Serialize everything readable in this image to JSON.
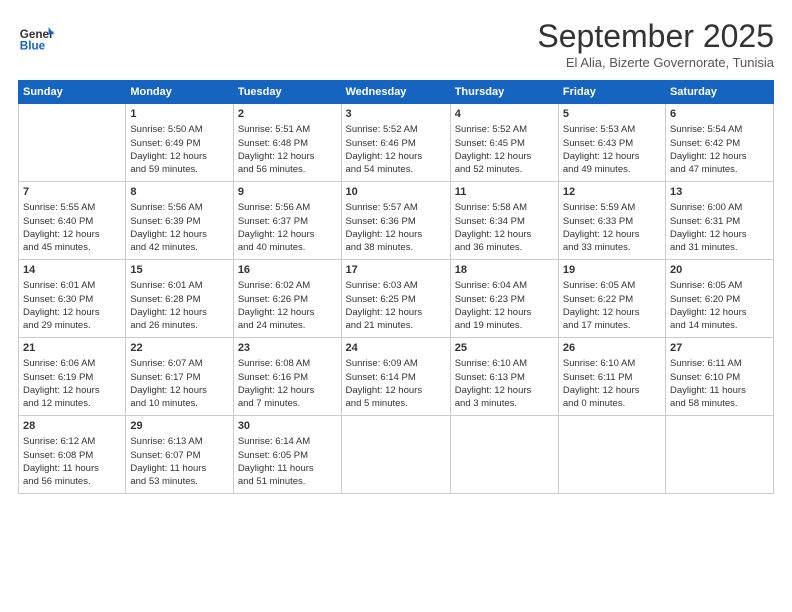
{
  "header": {
    "logo_general": "General",
    "logo_blue": "Blue",
    "month_title": "September 2025",
    "subtitle": "El Alia, Bizerte Governorate, Tunisia"
  },
  "columns": [
    "Sunday",
    "Monday",
    "Tuesday",
    "Wednesday",
    "Thursday",
    "Friday",
    "Saturday"
  ],
  "weeks": [
    [
      {
        "day": "",
        "info": ""
      },
      {
        "day": "1",
        "info": "Sunrise: 5:50 AM\nSunset: 6:49 PM\nDaylight: 12 hours\nand 59 minutes."
      },
      {
        "day": "2",
        "info": "Sunrise: 5:51 AM\nSunset: 6:48 PM\nDaylight: 12 hours\nand 56 minutes."
      },
      {
        "day": "3",
        "info": "Sunrise: 5:52 AM\nSunset: 6:46 PM\nDaylight: 12 hours\nand 54 minutes."
      },
      {
        "day": "4",
        "info": "Sunrise: 5:52 AM\nSunset: 6:45 PM\nDaylight: 12 hours\nand 52 minutes."
      },
      {
        "day": "5",
        "info": "Sunrise: 5:53 AM\nSunset: 6:43 PM\nDaylight: 12 hours\nand 49 minutes."
      },
      {
        "day": "6",
        "info": "Sunrise: 5:54 AM\nSunset: 6:42 PM\nDaylight: 12 hours\nand 47 minutes."
      }
    ],
    [
      {
        "day": "7",
        "info": "Sunrise: 5:55 AM\nSunset: 6:40 PM\nDaylight: 12 hours\nand 45 minutes."
      },
      {
        "day": "8",
        "info": "Sunrise: 5:56 AM\nSunset: 6:39 PM\nDaylight: 12 hours\nand 42 minutes."
      },
      {
        "day": "9",
        "info": "Sunrise: 5:56 AM\nSunset: 6:37 PM\nDaylight: 12 hours\nand 40 minutes."
      },
      {
        "day": "10",
        "info": "Sunrise: 5:57 AM\nSunset: 6:36 PM\nDaylight: 12 hours\nand 38 minutes."
      },
      {
        "day": "11",
        "info": "Sunrise: 5:58 AM\nSunset: 6:34 PM\nDaylight: 12 hours\nand 36 minutes."
      },
      {
        "day": "12",
        "info": "Sunrise: 5:59 AM\nSunset: 6:33 PM\nDaylight: 12 hours\nand 33 minutes."
      },
      {
        "day": "13",
        "info": "Sunrise: 6:00 AM\nSunset: 6:31 PM\nDaylight: 12 hours\nand 31 minutes."
      }
    ],
    [
      {
        "day": "14",
        "info": "Sunrise: 6:01 AM\nSunset: 6:30 PM\nDaylight: 12 hours\nand 29 minutes."
      },
      {
        "day": "15",
        "info": "Sunrise: 6:01 AM\nSunset: 6:28 PM\nDaylight: 12 hours\nand 26 minutes."
      },
      {
        "day": "16",
        "info": "Sunrise: 6:02 AM\nSunset: 6:26 PM\nDaylight: 12 hours\nand 24 minutes."
      },
      {
        "day": "17",
        "info": "Sunrise: 6:03 AM\nSunset: 6:25 PM\nDaylight: 12 hours\nand 21 minutes."
      },
      {
        "day": "18",
        "info": "Sunrise: 6:04 AM\nSunset: 6:23 PM\nDaylight: 12 hours\nand 19 minutes."
      },
      {
        "day": "19",
        "info": "Sunrise: 6:05 AM\nSunset: 6:22 PM\nDaylight: 12 hours\nand 17 minutes."
      },
      {
        "day": "20",
        "info": "Sunrise: 6:05 AM\nSunset: 6:20 PM\nDaylight: 12 hours\nand 14 minutes."
      }
    ],
    [
      {
        "day": "21",
        "info": "Sunrise: 6:06 AM\nSunset: 6:19 PM\nDaylight: 12 hours\nand 12 minutes."
      },
      {
        "day": "22",
        "info": "Sunrise: 6:07 AM\nSunset: 6:17 PM\nDaylight: 12 hours\nand 10 minutes."
      },
      {
        "day": "23",
        "info": "Sunrise: 6:08 AM\nSunset: 6:16 PM\nDaylight: 12 hours\nand 7 minutes."
      },
      {
        "day": "24",
        "info": "Sunrise: 6:09 AM\nSunset: 6:14 PM\nDaylight: 12 hours\nand 5 minutes."
      },
      {
        "day": "25",
        "info": "Sunrise: 6:10 AM\nSunset: 6:13 PM\nDaylight: 12 hours\nand 3 minutes."
      },
      {
        "day": "26",
        "info": "Sunrise: 6:10 AM\nSunset: 6:11 PM\nDaylight: 12 hours\nand 0 minutes."
      },
      {
        "day": "27",
        "info": "Sunrise: 6:11 AM\nSunset: 6:10 PM\nDaylight: 11 hours\nand 58 minutes."
      }
    ],
    [
      {
        "day": "28",
        "info": "Sunrise: 6:12 AM\nSunset: 6:08 PM\nDaylight: 11 hours\nand 56 minutes."
      },
      {
        "day": "29",
        "info": "Sunrise: 6:13 AM\nSunset: 6:07 PM\nDaylight: 11 hours\nand 53 minutes."
      },
      {
        "day": "30",
        "info": "Sunrise: 6:14 AM\nSunset: 6:05 PM\nDaylight: 11 hours\nand 51 minutes."
      },
      {
        "day": "",
        "info": ""
      },
      {
        "day": "",
        "info": ""
      },
      {
        "day": "",
        "info": ""
      },
      {
        "day": "",
        "info": ""
      }
    ]
  ]
}
